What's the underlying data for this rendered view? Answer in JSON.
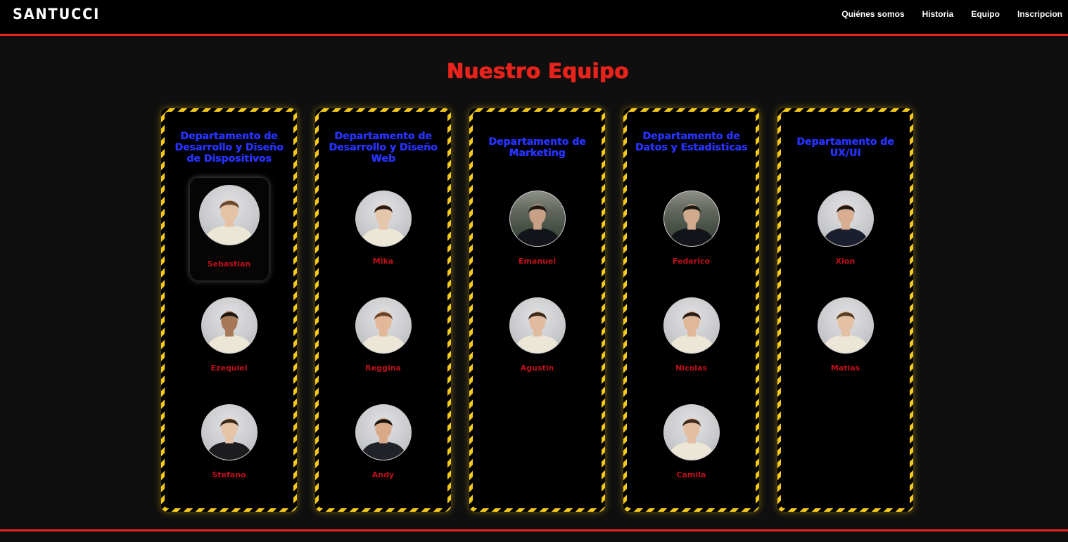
{
  "brand": "SANTUCCI",
  "nav": [
    "Quiénes somos",
    "Historia",
    "Equipo",
    "Inscripcion"
  ],
  "title": "Nuestro Equipo",
  "colors": {
    "accent_red": "#e8231b",
    "name_red": "#c0101a",
    "title_blue": "#2632ff",
    "stripe_yellow": "#f4c918",
    "background": "#0f0f0f"
  },
  "teams": [
    {
      "title": "Departamento de Desarrollo y Diseño de Dispositivos",
      "members": [
        {
          "name": "Sebastian",
          "shirt": "#ece6d6",
          "hair": "#6b4a2e",
          "skin": "#e4c2a6"
        },
        {
          "name": "Ezequiel",
          "shirt": "#ece6d6",
          "hair": "#1b1410",
          "skin": "#a77858"
        },
        {
          "name": "Stefano",
          "shirt": "#1c1c1f",
          "hair": "#3a2818",
          "skin": "#e6c4a8"
        }
      ]
    },
    {
      "title": "Departamento de Desarrollo y Diseño Web",
      "members": [
        {
          "name": "Mika",
          "shirt": "#ece6d6",
          "hair": "#2a1c14",
          "skin": "#e6c6ab"
        },
        {
          "name": "Reggina",
          "shirt": "#ece6d6",
          "hair": "#6a4428",
          "skin": "#e2b898"
        },
        {
          "name": "Andy",
          "shirt": "#1f2226",
          "hair": "#1a1410",
          "skin": "#d9a98a"
        }
      ]
    },
    {
      "title": "Departamento de Marketing",
      "members": [
        {
          "name": "Emanuel",
          "shirt": "#12141a",
          "hair": "#1d1712",
          "skin": "#c8a086"
        },
        {
          "name": "Agustin",
          "shirt": "#ece6d6",
          "hair": "#3a2a1c",
          "skin": "#e1bba0"
        }
      ]
    },
    {
      "title": "Departamento de Datos y Estadisticas",
      "members": [
        {
          "name": "Federico",
          "shirt": "#12141a",
          "hair": "#1d1712",
          "skin": "#d1aa8e"
        },
        {
          "name": "Nicolas",
          "shirt": "#ece6d6",
          "hair": "#2b1e14",
          "skin": "#e0b898"
        },
        {
          "name": "Camila",
          "shirt": "#ece6d6",
          "hair": "#3e2a1a",
          "skin": "#e3bea2"
        }
      ]
    },
    {
      "title": "Departamento de UX/UI",
      "members": [
        {
          "name": "Xion",
          "shirt": "#1a1e2e",
          "hair": "#1e1814",
          "skin": "#d8ad92"
        },
        {
          "name": "Matias",
          "shirt": "#ece6d6",
          "hair": "#5a3e26",
          "skin": "#e5c1a4"
        }
      ]
    }
  ]
}
